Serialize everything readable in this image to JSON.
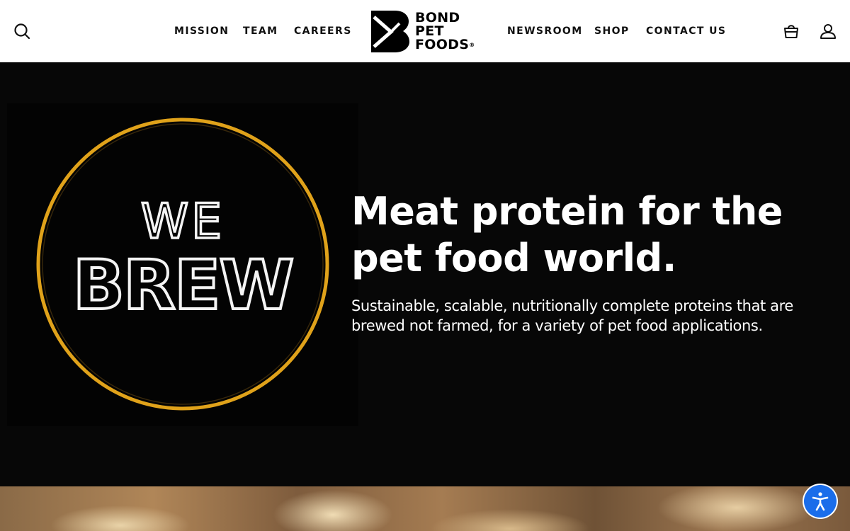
{
  "header": {
    "nav_left": [
      {
        "label": "MISSION"
      },
      {
        "label": "TEAM"
      },
      {
        "label": "CAREERS"
      }
    ],
    "nav_right": [
      {
        "label": "NEWSROOM"
      },
      {
        "label": "SHOP"
      },
      {
        "label": "CONTACT US"
      }
    ],
    "logo": {
      "line1": "BOND",
      "line2": "PET",
      "line3": "FOODS",
      "reg": "®"
    },
    "icons": {
      "search": "search-icon",
      "cart": "shopping-bag-icon",
      "account": "user-icon"
    }
  },
  "hero": {
    "image": {
      "line1": "WE",
      "line2": "BREW",
      "ring_color": "#e0a21a"
    },
    "title": "Meat protein for the pet food world.",
    "subtitle": "Sustainable, scalable, nutritionally complete proteins that are brewed not farmed, for a variety of pet food applications."
  },
  "accessibility": {
    "icon": "accessibility-icon",
    "color": "#1a6dea"
  }
}
